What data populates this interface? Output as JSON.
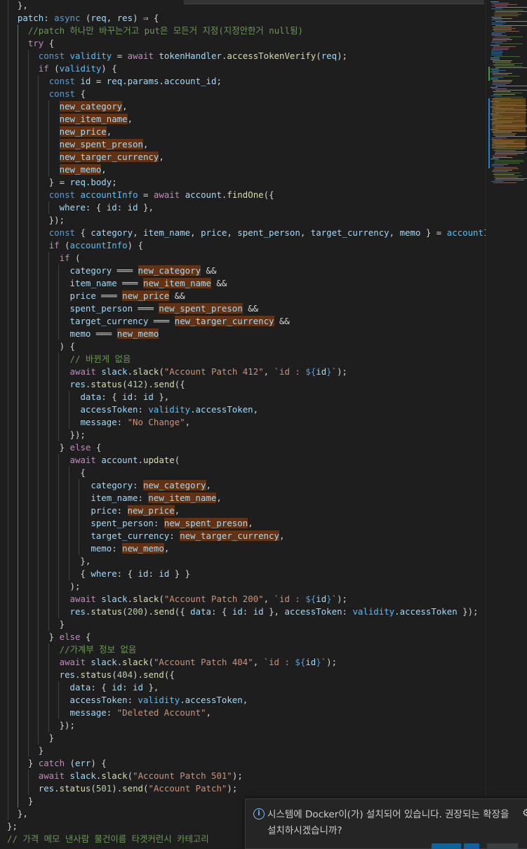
{
  "editor": {
    "lines": [
      "},",
      "patch: async (req, res) ⇒ {",
      "//patch 하나만 바꾸는거고 put은 모든거 지정(지정안한거 null됨)",
      "try {",
      "const validity = await tokenHandler.accessTokenVerify(req);",
      "if (validity) {",
      "const id = req.params.account_id;",
      "const {",
      "new_category,",
      "new_item_name,",
      "new_price,",
      "new_spent_preson,",
      "new_targer_currency,",
      "new_memo,",
      "} = req.body;",
      "const accountInfo = await account.findOne({",
      "where: { id: id },",
      "});",
      "const { category, item_name, price, spent_person, target_currency, memo } = accountInfo",
      "if (accountInfo) {",
      "if (",
      "category ═══ new_category &&",
      "item_name ═══ new_item_name &&",
      "price ═══ new_price &&",
      "spent_person ═══ new_spent_preson &&",
      "target_currency ═══ new_targer_currency &&",
      "memo ═══ new_memo",
      ") {",
      "// 바뀐게 없음",
      "await slack.slack(\"Account Patch 412\", `id : ${id}`);",
      "res.status(412).send({",
      "data: { id: id },",
      "accessToken: validity.accessToken,",
      "message: \"No Change\",",
      "});",
      "} else {",
      "await account.update(",
      "{",
      "category: new_category,",
      "item_name: new_item_name,",
      "price: new_price,",
      "spent_person: new_spent_preson,",
      "target_currency: new_targer_currency,",
      "memo: new_memo,",
      "},",
      "{ where: { id: id } }",
      ");",
      "await slack.slack(\"Account Patch 200\", `id : ${id}`);",
      "res.status(200).send({ data: { id: id }, accessToken: validity.accessToken });",
      "}",
      "} else {",
      "//가계부 정보 없음",
      "await slack.slack(\"Account Patch 404\", `id : ${id}`);",
      "res.status(404).send({",
      "data: { id: id },",
      "accessToken: validity.accessToken,",
      "message: \"Deleted Account\",",
      "});",
      "}",
      "}",
      "} catch (err) {",
      "await slack.slack(\"Account Patch 501\");",
      "res.status(501).send(\"Account Patch\");",
      "}",
      "},",
      "};",
      "// 가격 메모 낸사람 물건이름 타겟커런시 카테고리"
    ]
  },
  "notification": {
    "icon": "info-icon",
    "message": "시스템에 Docker이(가) 설치되어 있습니다. 권장되는 확장을 설치하시겠습니까?",
    "gear_icon": "gear-icon"
  },
  "colors": {
    "background": "#1e1e1e",
    "keyword": "#569cd6",
    "control": "#c586c0",
    "function": "#dcdcaa",
    "variable": "#9cdcfe",
    "string": "#ce9178",
    "number": "#b5cea8",
    "comment": "#6a9955",
    "highlight": "#613214"
  }
}
